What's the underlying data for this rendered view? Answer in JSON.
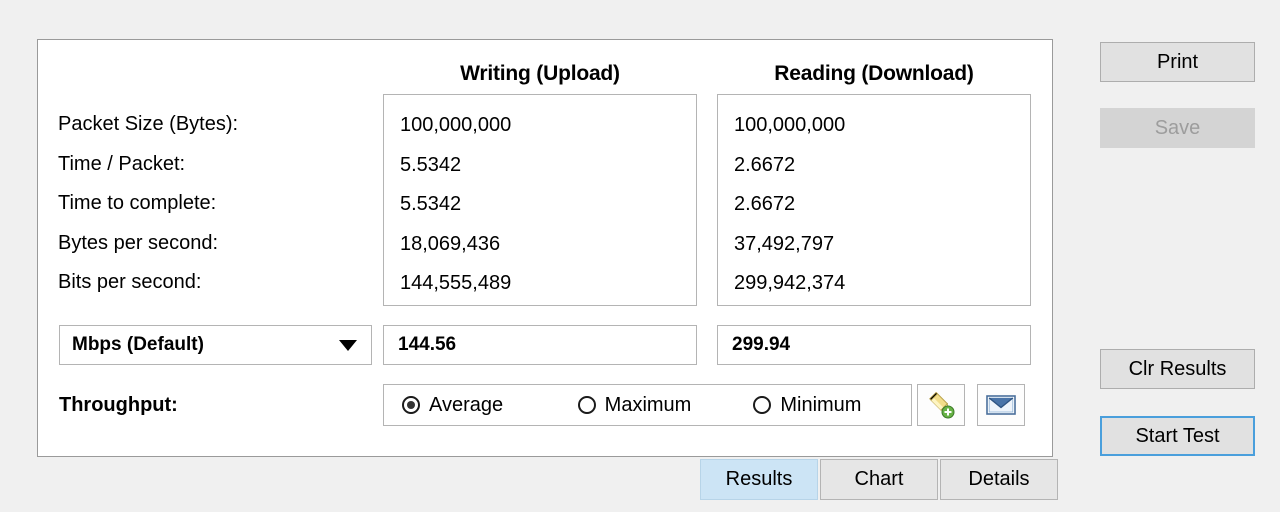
{
  "panel": {
    "headers": {
      "writing": "Writing (Upload)",
      "reading": "Reading (Download)"
    },
    "metric_labels": [
      "Packet Size (Bytes):",
      "Time / Packet:",
      "Time to complete:",
      "Bytes per second:",
      "Bits per second:"
    ],
    "writing_values": [
      "100,000,000",
      "5.5342",
      "5.5342",
      "18,069,436",
      "144,555,489"
    ],
    "reading_values": [
      "100,000,000",
      "2.6672",
      "2.6672",
      "37,492,797",
      "299,942,374"
    ],
    "unit_select": {
      "selected": "Mbps (Default)",
      "caret_icon": "chevron-down-icon"
    },
    "summary": {
      "writing": "144.56",
      "reading": "299.94"
    },
    "throughput": {
      "label": "Throughput:",
      "options": [
        {
          "label": "Average",
          "selected": true
        },
        {
          "label": "Maximum",
          "selected": false
        },
        {
          "label": "Minimum",
          "selected": false
        }
      ],
      "add_note_icon": "pencil-add-icon",
      "email_icon": "envelope-icon"
    }
  },
  "side_buttons": {
    "print": "Print",
    "save": "Save",
    "clr_results": "Clr Results",
    "start_test": "Start Test"
  },
  "tabs": [
    {
      "label": "Results",
      "active": true
    },
    {
      "label": "Chart",
      "active": false
    },
    {
      "label": "Details",
      "active": false
    }
  ],
  "colors": {
    "page_background": "#f0f0f0",
    "panel_background": "#ffffff",
    "panel_border": "#9a9a9a",
    "field_border": "#b4b4b4",
    "button_face": "#e1e1e1",
    "button_border": "#adadad",
    "disabled_text": "#9d9d9d",
    "active_tab": "#cce4f5",
    "focus_border": "#4a9fdc"
  }
}
